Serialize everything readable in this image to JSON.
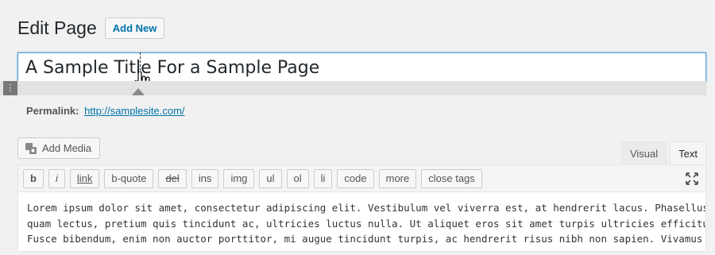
{
  "header": {
    "title": "Edit Page",
    "add_new_label": "Add New"
  },
  "title_field": {
    "value": "A Sample Title For a Sample Page"
  },
  "permalink": {
    "label": "Permalink:",
    "url": "http://samplesite.com/"
  },
  "media": {
    "add_media_label": "Add Media"
  },
  "editor_tabs": [
    {
      "label": "Visual"
    },
    {
      "label": "Text"
    }
  ],
  "quicktags": [
    {
      "label": "b"
    },
    {
      "label": "i"
    },
    {
      "label": "link"
    },
    {
      "label": "b-quote"
    },
    {
      "label": "del"
    },
    {
      "label": "ins"
    },
    {
      "label": "img"
    },
    {
      "label": "ul"
    },
    {
      "label": "ol"
    },
    {
      "label": "li"
    },
    {
      "label": "code"
    },
    {
      "label": "more"
    },
    {
      "label": "close tags"
    }
  ],
  "content": {
    "lines": [
      "Lorem ipsum dolor sit amet, consectetur adipiscing elit. Vestibulum vel viverra est, at hendrerit lacus. Phasellus",
      "quam lectus, pretium quis tincidunt ac, ultricies luctus nulla. Ut aliquet eros sit amet turpis ultricies efficitur.",
      "Fusce bibendum, enim non auctor porttitor, mi augue tincidunt turpis, ac hendrerit risus nibh non sapien. Vivamus quis"
    ]
  }
}
